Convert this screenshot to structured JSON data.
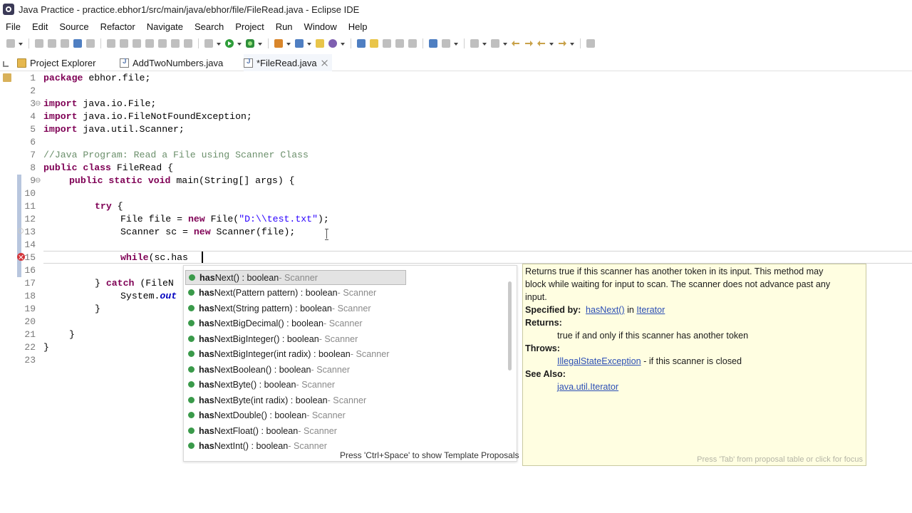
{
  "window": {
    "title": "Java Practice - practice.ebhor1/src/main/java/ebhor/file/FileRead.java - Eclipse IDE"
  },
  "menu": [
    "File",
    "Edit",
    "Source",
    "Refactor",
    "Navigate",
    "Search",
    "Project",
    "Run",
    "Window",
    "Help"
  ],
  "tabs": {
    "project_explorer": "Project Explorer",
    "add_two": "AddTwoNumbers.java",
    "file_read": "*FileRead.java"
  },
  "editor": {
    "line_numbers": [
      "1",
      "2",
      "3",
      "4",
      "5",
      "6",
      "7",
      "8",
      "9",
      "10",
      "11",
      "12",
      "13",
      "14",
      "15",
      "16",
      "17",
      "18",
      "19",
      "20",
      "21",
      "22",
      "23"
    ],
    "line1": {
      "kw": "package",
      "rest": " ebhor.file;"
    },
    "line3": {
      "kw": "import",
      "rest": " java.io.File;"
    },
    "line4": {
      "kw": "import",
      "rest": " java.io.FileNotFoundException;"
    },
    "line5": {
      "kw": "import",
      "rest": " java.util.Scanner;"
    },
    "line7": {
      "comment": "//Java Program: Read a File using Scanner Class"
    },
    "line8": {
      "kw1": "public",
      "kw2": "class",
      "rest": " FileRead {"
    },
    "line9": {
      "kw1": "public",
      "kw2": "static",
      "kw3": "void",
      "rest": " main(String[] args) {"
    },
    "line11": {
      "kw": "try",
      "rest": " {"
    },
    "line12": {
      "a": "File file = ",
      "kw": "new",
      "b": " File(",
      "str": "\"D:\\\\test.txt\"",
      "c": ");"
    },
    "line13": {
      "a": "Scanner sc = ",
      "kw": "new",
      "b": " Scanner(file);"
    },
    "line15": {
      "kw": "while",
      "rest": "(sc.has"
    },
    "line17": {
      "a": "} ",
      "kw": "catch",
      "b": " (FileN"
    },
    "line18": {
      "a": "System.",
      "b": "out"
    },
    "line19": {
      "text": "}"
    },
    "line21": {
      "text": "}"
    },
    "line22": {
      "text": "}"
    }
  },
  "proposals": {
    "items": [
      {
        "match": "has",
        "rest": "Next() : boolean",
        "owner": " - Scanner"
      },
      {
        "match": "has",
        "rest": "Next(Pattern pattern) : boolean",
        "owner": " - Scanner"
      },
      {
        "match": "has",
        "rest": "Next(String pattern) : boolean",
        "owner": " - Scanner"
      },
      {
        "match": "has",
        "rest": "NextBigDecimal() : boolean",
        "owner": " - Scanner"
      },
      {
        "match": "has",
        "rest": "NextBigInteger() : boolean",
        "owner": " - Scanner"
      },
      {
        "match": "has",
        "rest": "NextBigInteger(int radix) : boolean",
        "owner": " - Scanner"
      },
      {
        "match": "has",
        "rest": "NextBoolean() : boolean",
        "owner": " - Scanner"
      },
      {
        "match": "has",
        "rest": "NextByte() : boolean",
        "owner": " - Scanner"
      },
      {
        "match": "has",
        "rest": "NextByte(int radix) : boolean",
        "owner": " - Scanner"
      },
      {
        "match": "has",
        "rest": "NextDouble() : boolean",
        "owner": " - Scanner"
      },
      {
        "match": "has",
        "rest": "NextFloat() : boolean",
        "owner": " - Scanner"
      },
      {
        "match": "has",
        "rest": "NextInt() : boolean",
        "owner": " - Scanner"
      }
    ],
    "footer": "Press 'Ctrl+Space' to show Template Proposals"
  },
  "javadoc": {
    "desc1": "Returns true if this scanner has another token in its input. This method may",
    "desc2": "block while waiting for input to scan. The scanner does not advance past any",
    "desc3": "input.",
    "specified_by_label": "Specified by:",
    "specified_by_link1": "hasNext()",
    "specified_by_in": " in ",
    "specified_by_link2": "Iterator",
    "returns_label": "Returns:",
    "returns_text": "true if and only if this scanner has another token",
    "throws_label": "Throws:",
    "throws_link": "IllegalStateException",
    "throws_text": " - if this scanner is closed",
    "see_also_label": "See Also:",
    "see_also_link": "java.util.Iterator",
    "footer": "Press 'Tab' from proposal table or click for focus"
  }
}
